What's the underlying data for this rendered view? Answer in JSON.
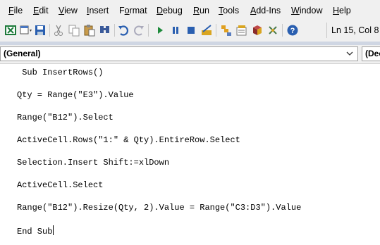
{
  "menu": [
    {
      "pre": "",
      "u": "F",
      "post": "ile"
    },
    {
      "pre": "",
      "u": "E",
      "post": "dit"
    },
    {
      "pre": "",
      "u": "V",
      "post": "iew"
    },
    {
      "pre": "",
      "u": "I",
      "post": "nsert"
    },
    {
      "pre": "F",
      "u": "o",
      "post": "rmat"
    },
    {
      "pre": "",
      "u": "D",
      "post": "ebug"
    },
    {
      "pre": "",
      "u": "R",
      "post": "un"
    },
    {
      "pre": "",
      "u": "T",
      "post": "ools"
    },
    {
      "pre": "",
      "u": "A",
      "post": "dd-Ins"
    },
    {
      "pre": "",
      "u": "W",
      "post": "indow"
    },
    {
      "pre": "",
      "u": "H",
      "post": "elp"
    }
  ],
  "toolbar": {
    "icons": [
      "excel-view-icon",
      "insert-module-icon",
      "save-icon",
      "cut-icon",
      "copy-icon",
      "paste-icon",
      "find-icon",
      "undo-icon",
      "redo-icon",
      "run-icon",
      "break-icon",
      "reset-icon",
      "design-mode-icon",
      "project-explorer-icon",
      "properties-icon",
      "object-browser-icon",
      "toolbox-icon",
      "help-icon"
    ],
    "cursor_position": "Ln 15, Col 8",
    "accent_green": "#1d8a3a",
    "accent_blue": "#2a5fb0"
  },
  "dropdowns": {
    "object": "(General)",
    "procedure": "(Dec"
  },
  "code_lines": [
    " Sub InsertRows()",
    "Qty = Range(\"E3\").Value",
    "Range(\"B12\").Select",
    "ActiveCell.Rows(\"1:\" & Qty).EntireRow.Select",
    "Selection.Insert Shift:=xlDown",
    "ActiveCell.Select",
    "Range(\"B12\").Resize(Qty, 2).Value = Range(\"C3:D3\").Value",
    "End Sub"
  ]
}
